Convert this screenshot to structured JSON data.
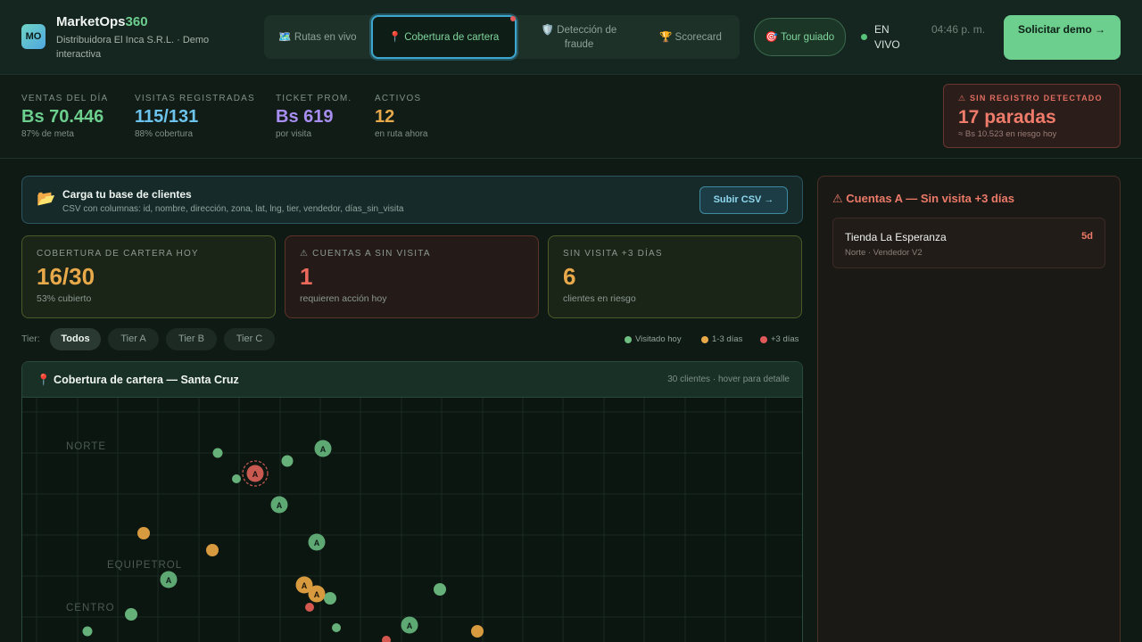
{
  "brand": {
    "badge": "MO",
    "name_main": "MarketOps",
    "name_accent": "360",
    "subtitle": "Distribuidora El Inca S.R.L. · Demo interactiva"
  },
  "tabs": [
    {
      "label": "🗺️ Rutas en vivo",
      "active": false
    },
    {
      "label": "📍 Cobertura de cartera",
      "active": true
    },
    {
      "label": "🛡️ Detección de fraude",
      "active": false
    },
    {
      "label": "🏆 Scorecard",
      "active": false
    }
  ],
  "header": {
    "tour_label": "🎯 Tour guiado",
    "live_label": "EN VIVO",
    "clock": "04:46 p. m.",
    "demo_label": "Solicitar demo →"
  },
  "kpis": [
    {
      "label": "VENTAS DEL DÍA",
      "value": "Bs 70.446",
      "sub": "87% de meta",
      "color": "#6ccf8e"
    },
    {
      "label": "VISITAS REGISTRADAS",
      "value": "115/131",
      "sub": "88% cobertura",
      "color": "#6cc3ec"
    },
    {
      "label": "TICKET PROM.",
      "value": "Bs 619",
      "sub": "por visita",
      "color": "#a88ef0"
    },
    {
      "label": "ACTIVOS",
      "value": "12",
      "sub": "en ruta ahora",
      "color": "#e8a94a"
    }
  ],
  "alert": {
    "title": "⚠ SIN REGISTRO DETECTADO",
    "value": "17 paradas",
    "sub": "≈ Bs 10.523 en riesgo hoy"
  },
  "upload": {
    "icon": "📂",
    "title": "Carga tu base de clientes",
    "sub": "CSV con columnas: id, nombre, dirección, zona, lat, lng, tier, vendedor, días_sin_visita",
    "button": "Subir CSV →"
  },
  "cards": [
    {
      "label": "COBERTURA DE CARTERA HOY",
      "value": "16/30",
      "sub": "53% cubierto",
      "color": "#e8a94a"
    },
    {
      "label": "⚠ CUENTAS A SIN VISITA",
      "value": "1",
      "sub": "requieren acción hoy",
      "color": "#ec6a5c"
    },
    {
      "label": "SIN VISITA +3 DÍAS",
      "value": "6",
      "sub": "clientes en riesgo",
      "color": "#e8a94a"
    }
  ],
  "filter": {
    "label": "Tier:",
    "chips": [
      "Todos",
      "Tier A",
      "Tier B",
      "Tier C"
    ],
    "active": "Todos"
  },
  "legend": [
    {
      "label": "Visitado hoy",
      "color": "#6fbf83"
    },
    {
      "label": "1-3 días",
      "color": "#e8a94a"
    },
    {
      "label": "+3 días",
      "color": "#e05a5a"
    }
  ],
  "map": {
    "title": "📍 Cobertura de cartera — Santa Cruz",
    "meta": "30 clientes · hover para detalle",
    "zones": [
      "NORTE",
      "EQUIPETROL",
      "CENTRO"
    ],
    "tier_letter": "A"
  },
  "side_panel": {
    "title": "⚠ Cuentas A — Sin visita +3 días",
    "items": [
      {
        "name": "Tienda La Esperanza",
        "meta": "Norte · Vendedor V2",
        "days": "5d"
      }
    ]
  }
}
